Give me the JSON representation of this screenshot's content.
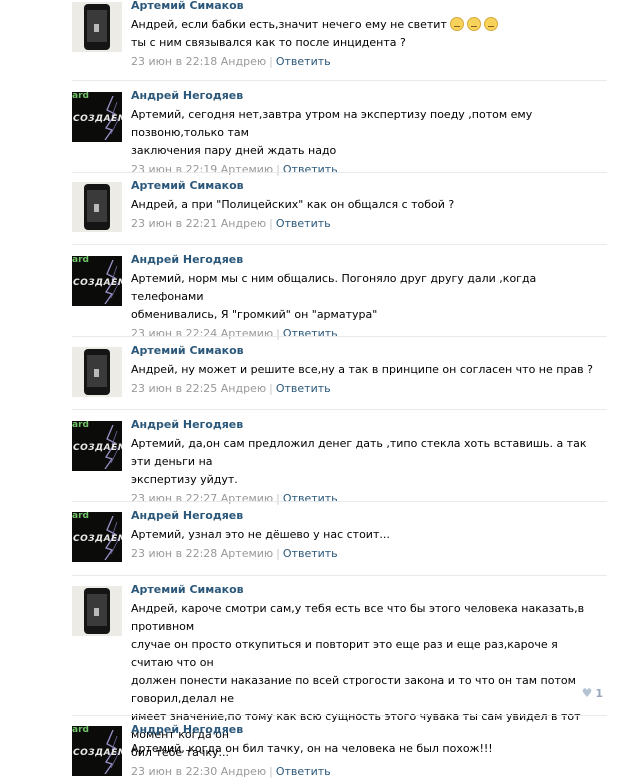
{
  "thread": {
    "posts": [
      {
        "author": "Артемий Симаков",
        "avatar": "phone-photo",
        "lines": [
          "Андрей, если бабки есть,значит нечего ему не светит",
          "ты с ним связывался как то после инцидента ?"
        ],
        "emoji_count": 3,
        "date": "23 июн в 22:18",
        "reply_to": "Андрею",
        "reply_label": "Ответить"
      },
      {
        "author": "Андрей Негодяев",
        "avatar": "dark-logo",
        "avatar_text": {
          "tag": "ard",
          "logo": "СОЗДАЕМ"
        },
        "lines": [
          "Артемий, сегодня нет,завтра утром на экспертизу поеду ,потом ему позвоню,только там",
          "заключения пару дней ждать надо"
        ],
        "date": "23 июн в 22:19",
        "reply_to": "Артемию",
        "reply_label": "Ответить"
      },
      {
        "author": "Артемий Симаков",
        "avatar": "phone-photo",
        "lines": [
          "Андрей, а при \"Полицейских\" как он общался с тобой ?"
        ],
        "date": "23 июн в 22:21",
        "reply_to": "Андрею",
        "reply_label": "Ответить"
      },
      {
        "author": "Андрей Негодяев",
        "avatar": "dark-logo",
        "avatar_text": {
          "tag": "ard",
          "logo": "СОЗДАЕМ"
        },
        "lines": [
          "Артемий, норм мы с ним общались. Погоняло друг другу дали ,когда телефонами",
          "обменивались, Я \"громкий\" он \"арматура\""
        ],
        "date": "23 июн в 22:24",
        "reply_to": "Артемию",
        "reply_label": "Ответить"
      },
      {
        "author": "Артемий Симаков",
        "avatar": "phone-photo",
        "lines": [
          "Андрей, ну может и решите все,ну а так в принципе он согласен что не прав ?"
        ],
        "date": "23 июн в 22:25",
        "reply_to": "Андрею",
        "reply_label": "Ответить"
      },
      {
        "author": "Андрей Негодяев",
        "avatar": "dark-logo",
        "avatar_text": {
          "tag": "ard",
          "logo": "СОЗДАЕМ"
        },
        "lines": [
          "Артемий, да,он сам предложил денег дать ,типо стекла хоть вставишь. а так эти деньги на",
          "экспертизу уйдут."
        ],
        "date": "23 июн в 22:27",
        "reply_to": "Артемию",
        "reply_label": "Ответить"
      },
      {
        "author": "Андрей Негодяев",
        "avatar": "dark-logo",
        "avatar_text": {
          "tag": "ard",
          "logo": "СОЗДАЕМ"
        },
        "lines": [
          "Артемий, узнал это не дёшево у нас стоит..."
        ],
        "date": "23 июн в 22:28",
        "reply_to": "Артемию",
        "reply_label": "Ответить"
      },
      {
        "author": "Артемий Симаков",
        "avatar": "phone-photo",
        "lines": [
          "Андрей, кароче смотри сам,у тебя есть все что бы этого человека наказать,в противном",
          "случае он просто откупиться и повторит это еще раз и еще раз,кароче я считаю что он",
          "должен понести наказание по всей строгости закона и то что он там потом говорил,делал не",
          "имеет значение,по тому как всю сущность этого чувака ты сам увидел в тот момент когда он",
          "бил тебе тачку..."
        ],
        "date": "23 июн в 22:30",
        "reply_to": "Андрею",
        "reply_label": "Ответить",
        "likes": "1"
      },
      {
        "author": "Андрей Негодяев",
        "avatar": "dark-logo",
        "avatar_text": {
          "tag": "ard",
          "logo": "СОЗДАЕМ"
        },
        "lines": [
          "Артемий, когда он бил тачку, он на человека не был похож!!!"
        ],
        "date": "",
        "reply_to": "",
        "reply_label": ""
      }
    ]
  },
  "colors": {
    "author": "#2b587a",
    "meta": "#999999",
    "separator": "#e7eaed",
    "likes": "#98a8ba"
  }
}
